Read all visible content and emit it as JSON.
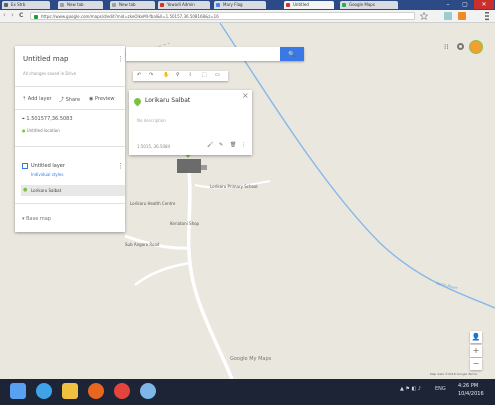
{
  "tabs": [
    {
      "label": "Ex Strb",
      "color": "#5f6368"
    },
    {
      "label": "New tab",
      "color": "#9aa0a6"
    },
    {
      "label": "New tab",
      "color": "#9aa0a6"
    },
    {
      "label": "Yowadi Admin",
      "color": "#d93025"
    },
    {
      "label": "Mary Flag",
      "color": "#4285f4"
    },
    {
      "label": "Untitled",
      "color": "#d93025"
    },
    {
      "label": "Google Maps",
      "color": "#34a853"
    }
  ],
  "window_controls": {
    "minimize": "–",
    "maximize": "▢",
    "close": "✕"
  },
  "toolbar": {
    "back": "‹",
    "forward": "›",
    "reload": "C",
    "url": "https://www.google.com/maps/d/edit?mid=zkeOlkeMI-fbaI&ll=1.50157,36.508168&z=16"
  },
  "panel": {
    "map_title": "Untitled map",
    "map_subtitle": "All changes saved in Drive",
    "menu_icon": "⋮",
    "actions": {
      "add_layer": "Add layer",
      "share": "Share",
      "preview": "Preview"
    },
    "coordinates": "1.501577,36.5083",
    "location": "Untitled location",
    "layer_name": "Untitled layer",
    "layer_style": "Individual styles",
    "place_name": "Lorikaru Salbat",
    "base_map": "Base map"
  },
  "search": {
    "placeholder": "",
    "button_icon": "🔍"
  },
  "edit_tools": [
    "↶",
    "↷",
    "✋",
    "⚲",
    "⌇",
    "⬚",
    "▭"
  ],
  "popup": {
    "title": "Lorikaru Salbat",
    "close": "×",
    "description": "No description",
    "coords": "1.5015, 36.5084",
    "icons": [
      "🖌",
      "✎",
      "🗑",
      "⋮"
    ]
  },
  "map_labels": {
    "school": "Lorikaru Primary School",
    "center": "Lorikaru Health Centre",
    "shop": "Keriatoni Shop",
    "road": "Sub Angoro Road",
    "river": "Kerio River",
    "google": "Google My Maps",
    "attribution": "Map data ©2016 Google   Terms"
  },
  "map_controls": {
    "zoom_in": "+",
    "zoom_out": "−",
    "pegman": "👤"
  },
  "taskbar": {
    "icons": [
      {
        "name": "windows",
        "color": "#5aa0f0"
      },
      {
        "name": "ie",
        "color": "#3fa3e8"
      },
      {
        "name": "folder",
        "color": "#f0c040"
      },
      {
        "name": "firefox",
        "color": "#e8661d"
      },
      {
        "name": "chrome",
        "color": "#e3453d"
      },
      {
        "name": "media",
        "color": "#7eb6e8"
      }
    ],
    "tray": "ENG",
    "time": "4:26 PM",
    "date": "10/4/2016"
  },
  "colors": {
    "accent": "#3b78e7",
    "tabbar": "#2b4a86",
    "taskbar": "#1c2435",
    "map": "#eae7df",
    "road": "#ffffff",
    "river": "#86b8e8"
  }
}
